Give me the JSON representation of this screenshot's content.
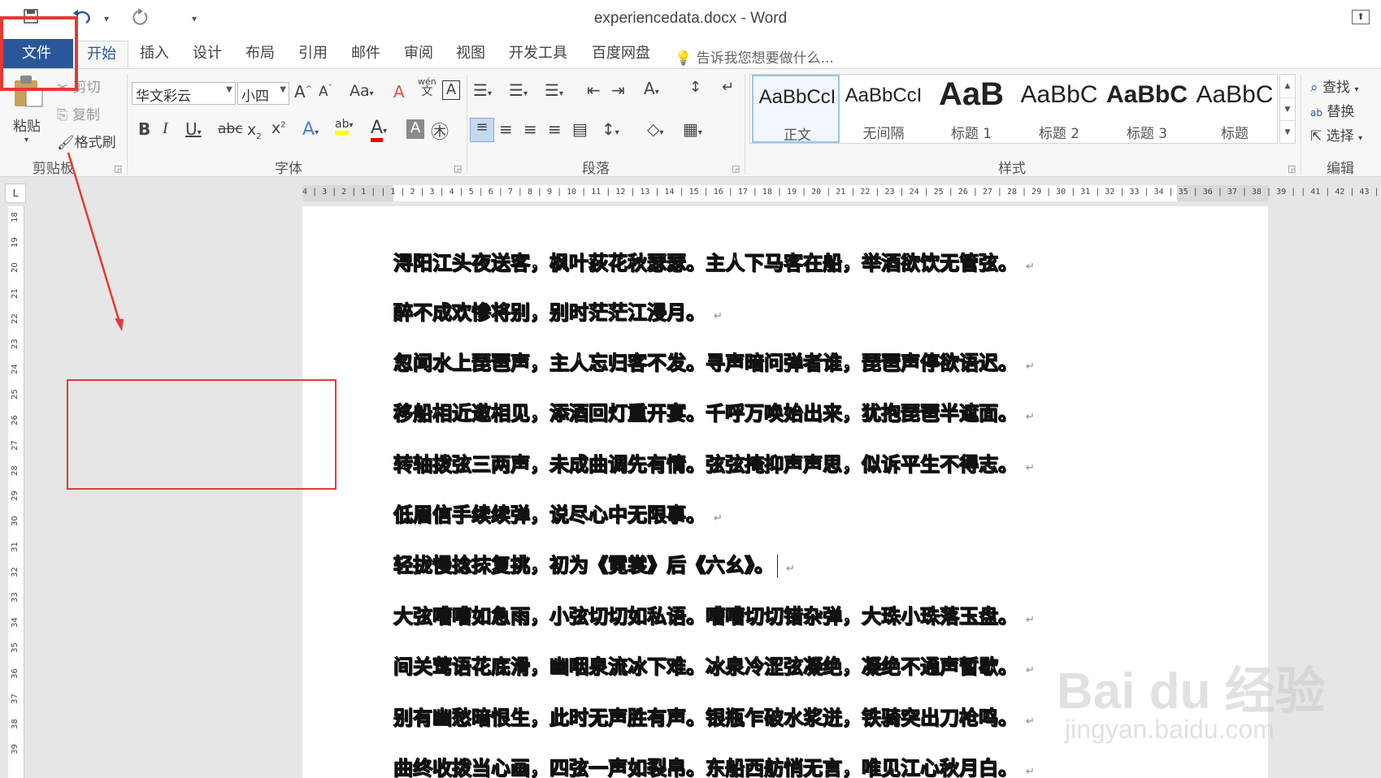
{
  "window": {
    "title": "experiencedata.docx - Word"
  },
  "quick_access": {
    "save_icon": "save-icon",
    "undo_icon": "undo-icon",
    "redo_icon": "redo-icon"
  },
  "tabs": [
    {
      "label": "文件"
    },
    {
      "label": "开始"
    },
    {
      "label": "插入"
    },
    {
      "label": "设计"
    },
    {
      "label": "布局"
    },
    {
      "label": "引用"
    },
    {
      "label": "邮件"
    },
    {
      "label": "审阅"
    },
    {
      "label": "视图"
    },
    {
      "label": "开发工具"
    },
    {
      "label": "百度网盘"
    }
  ],
  "tell_me": "告诉我您想要做什么...",
  "clipboard": {
    "paste": "粘贴",
    "cut": "剪切",
    "copy": "复制",
    "format_painter": "格式刷",
    "group": "剪贴板"
  },
  "font": {
    "name": "华文彩云",
    "size": "小四",
    "aa": "Aa",
    "wen_top": "wén",
    "wen_bottom": "文",
    "group": "字体"
  },
  "paragraph": {
    "group": "段落"
  },
  "styles": {
    "group": "样式",
    "items": [
      {
        "preview": "AaBbCcI",
        "name": "正文"
      },
      {
        "preview": "AaBbCcI",
        "name": "无间隔"
      },
      {
        "preview": "AaB",
        "name": "标题 1"
      },
      {
        "preview": "AaBbC",
        "name": "标题 2"
      },
      {
        "preview": "AaBbC",
        "name": "标题 3"
      },
      {
        "preview": "AaBbC",
        "name": "标题"
      }
    ]
  },
  "editing": {
    "find": "查找",
    "replace": "替换",
    "select": "选择",
    "group": "编辑"
  },
  "ruler": {
    "ticks": "4 | 3 | 2 | 1 |   | 1 | 2 | 3 | 4 | 5 | 6 | 7 | 8 | 9 | 10 | 11 | 12 | 13 | 14 | 15 | 16 | 17 | 18 | 19 | 20 | 21 | 22 | 23 | 24 | 25 | 26 | 27 | 28 | 29 | 30 | 31 | 32 | 33 | 34 | 35 | 36 | 37 | 38 | 39 |   | 41 | 42 | 43 | 44"
  },
  "vruler": [
    "18",
    "19",
    "20",
    "21",
    "22",
    "23",
    "24",
    "25",
    "26",
    "27",
    "28",
    "29",
    "30",
    "31",
    "32",
    "33",
    "34",
    "35",
    "36",
    "37",
    "38",
    "39"
  ],
  "document": {
    "lines": [
      "浔阳江头夜送客，枫叶荻花秋瑟瑟。主人下马客在船，举酒欲饮无管弦。",
      "醉不成欢惨将别，别时茫茫江浸月。",
      "忽闻水上琵琶声，主人忘归客不发。寻声暗问弹者谁，琵琶声停欲语迟。",
      "移船相近邀相见，添酒回灯重开宴。千呼万唤始出来，犹抱琵琶半遮面。",
      "转轴拨弦三两声，未成曲调先有情。弦弦掩抑声声思，似诉平生不得志。",
      "低眉信手续续弹，说尽心中无限事。",
      "轻拢慢捻抹复挑，初为《霓裳》后《六幺》。",
      "大弦嘈嘈如急雨，小弦切切如私语。嘈嘈切切错杂弹，大珠小珠落玉盘。",
      "间关莺语花底滑，幽咽泉流冰下难。冰泉冷涩弦凝绝，凝绝不通声暂歇。",
      "别有幽愁暗恨生，此时无声胜有声。银瓶乍破水浆迸，铁骑突出刀枪鸣。",
      "曲终收拨当心画，四弦一声如裂帛。东船西舫悄无言，唯见江心秋月白。"
    ],
    "paragraph_mark": "↵"
  },
  "watermark": {
    "main": "Bai du 经验",
    "sub": "jingyan.baidu.com"
  },
  "colors": {
    "accent": "#2b579a",
    "annotation": "#e53935"
  }
}
